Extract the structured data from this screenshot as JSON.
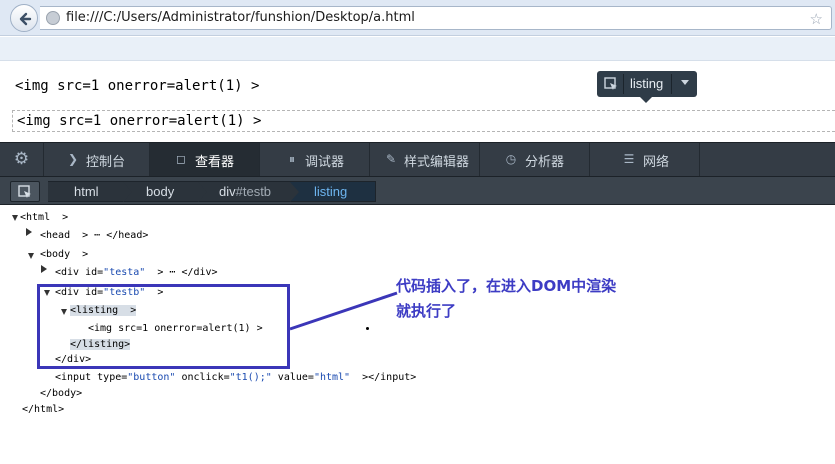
{
  "browser": {
    "url": "file:///C:/Users/Administrator/funshion/Desktop/a.html"
  },
  "page": {
    "line1": "<img src=1 onerror=alert(1) >",
    "line2": "<img src=1 onerror=alert(1) >"
  },
  "inspector_tooltip": {
    "label": "listing"
  },
  "devtools": {
    "tabs": [
      {
        "label": "控制台",
        "icon": "chevron-right-icon"
      },
      {
        "label": "查看器",
        "icon": "inspector-icon"
      },
      {
        "label": "调试器",
        "icon": "pause-icon"
      },
      {
        "label": "样式编辑器",
        "icon": "pencil-icon"
      },
      {
        "label": "分析器",
        "icon": "stopwatch-icon"
      },
      {
        "label": "网络",
        "icon": "network-icon"
      }
    ],
    "breadcrumbs": [
      {
        "tag": "html",
        "id": ""
      },
      {
        "tag": "body",
        "id": ""
      },
      {
        "tag": "div",
        "id": "#testb"
      },
      {
        "tag": "listing",
        "id": ""
      }
    ]
  },
  "tree": {
    "html_open": "<html  >",
    "head": "<head  > ⋯ </head>",
    "body_open": "<body  >",
    "div_testa_tag": "<div ",
    "div_testa_attr": "id=",
    "div_testa_val": "\"testa\"",
    "div_testa_rest": "  > ⋯ </div>",
    "div_testb_tag": "<div ",
    "div_testb_attr": "id=",
    "div_testb_val": "\"testb\"",
    "div_testb_rest": "  >",
    "listing_open": "<listing  >",
    "img_text": "<img src=1 onerror=alert(1) >",
    "listing_close": "</listing>",
    "div_close": "</div>",
    "input_tag": "<input ",
    "input_a1": "type=",
    "input_v1": "\"button\"",
    "input_a2": " onclick=",
    "input_v2": "\"t1();\"",
    "input_a3": " value=",
    "input_v3": "\"html\"",
    "input_rest": "  ></input>",
    "body_close": "</body>",
    "html_close": "</html>"
  },
  "annotation": {
    "text": "代码插入了，在进入DOM中渲染就执行了"
  },
  "colors": {
    "annotation": "#3b36b8",
    "attr_value": "#1a4ab0",
    "selected_crumb": "#6db5f0"
  }
}
